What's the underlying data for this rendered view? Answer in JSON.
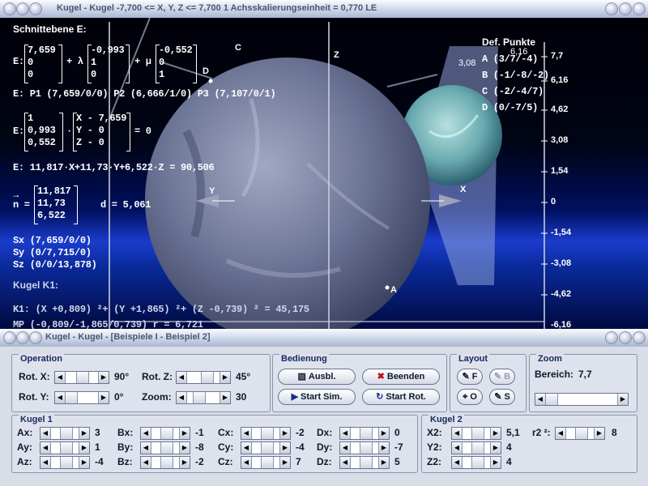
{
  "window": {
    "title": "Kugel - Kugel   -7,700 <= X, Y, Z <= 7,700    1 Achsskalierungseinheit = 0,770 LE"
  },
  "subwindow": {
    "title": "Kugel - Kugel - [Beispiele I - Beispiel 2]"
  },
  "scene": {
    "lines": [
      "Schnittebene E:",
      "E: P1 (7,659/0/0)   P2 (6,666/1/0)   P3 (7,107/0/1)",
      "E: 11,817·X+11,73·Y+6,522·Z = 90,506",
      "Sx (7,659/0/0)",
      "Sy (0/7,715/0)",
      "Sz (0/0/13,878)",
      "Kugel K1:",
      "K1: (X +0,809) ²+ (Y +1,865) ²+ (Z -0,739) ² = 45,175",
      "MP (-0,809/-1,865/0,739)  r = 6,721"
    ],
    "vec_E_p": [
      "7,659",
      "0",
      "0"
    ],
    "vec_E_u": [
      "-0,993",
      "1",
      "0"
    ],
    "vec_E_v": [
      "-0,552",
      "0",
      "1"
    ],
    "plus_lambda": "+ λ",
    "plus_mu": "+ μ",
    "E_prefix": "E:",
    "normal_vec": [
      "1",
      "0,993",
      "0,552"
    ],
    "xyz_vec": [
      "X - 7,659",
      "Y - 0",
      "Z - 0"
    ],
    "dot": "·",
    "eq_zero": "= 0",
    "n_arrow": "→",
    "n_label": "n =",
    "n_vec": [
      "11,817",
      "11,73",
      "6,522"
    ],
    "d_text": "d = 5,061",
    "def_title": "Def. Punkte",
    "def_points": [
      "A (3/7/-4)",
      "B (-1/-8/-2)",
      "C (-2/-4/7)",
      "D (0/-7/5)"
    ],
    "axis_ticks": [
      "7,7",
      "6,16",
      "4,62",
      "3,08",
      "1,54",
      "0",
      "-1,54",
      "-3,08",
      "-4,62",
      "-6,16"
    ],
    "pt_labels": {
      "c": "C",
      "d": "D",
      "a": "A",
      "y": "Y",
      "x": "X",
      "z": "Z"
    },
    "misc_ticks": [
      "3,08",
      "6,16"
    ]
  },
  "operation": {
    "title": "Operation",
    "rot_x": {
      "label": "Rot. X:",
      "value": "90°",
      "pos": 0.5
    },
    "rot_y": {
      "label": "Rot. Y:",
      "value": "0°",
      "pos": 0.0
    },
    "rot_z": {
      "label": "Rot. Z:",
      "value": "45°",
      "pos": 0.625
    },
    "zoom": {
      "label": "Zoom:",
      "value": "30",
      "pos": 0.3
    }
  },
  "bedienung": {
    "title": "Bedienung",
    "ausbl": "Ausbl.",
    "beenden": "Beenden",
    "start_sim": "Start Sim.",
    "start_rot": "Start Rot."
  },
  "layout": {
    "title": "Layout",
    "f": "F",
    "b": "B",
    "o": "O",
    "s": "S"
  },
  "zoom_group": {
    "title": "Zoom",
    "bereich_label": "Bereich:",
    "bereich_value": "7,7"
  },
  "kugel1": {
    "title": "Kugel 1",
    "rows": [
      [
        {
          "label": "Ax:",
          "value": "3"
        },
        {
          "label": "Bx:",
          "value": "-1"
        },
        {
          "label": "Cx:",
          "value": "-2"
        },
        {
          "label": "Dx:",
          "value": "0"
        }
      ],
      [
        {
          "label": "Ay:",
          "value": "1"
        },
        {
          "label": "By:",
          "value": "-8"
        },
        {
          "label": "Cy:",
          "value": "-4"
        },
        {
          "label": "Dy:",
          "value": "-7"
        }
      ],
      [
        {
          "label": "Az:",
          "value": "-4"
        },
        {
          "label": "Bz:",
          "value": "-2"
        },
        {
          "label": "Cz:",
          "value": "7"
        },
        {
          "label": "Dz:",
          "value": "5"
        }
      ]
    ]
  },
  "kugel2": {
    "title": "Kugel 2",
    "x2": {
      "label": "X2:",
      "value": "5,1"
    },
    "y2": {
      "label": "Y2:",
      "value": "4"
    },
    "z2": {
      "label": "Z2:",
      "value": "4"
    },
    "r2": {
      "label": "r2 ²:",
      "value": "8"
    }
  },
  "colors": {
    "accent": "#1a2a60",
    "scene_bg": "#000414",
    "sphere1": "#6a7294",
    "sphere2": "#6fb4b4"
  }
}
